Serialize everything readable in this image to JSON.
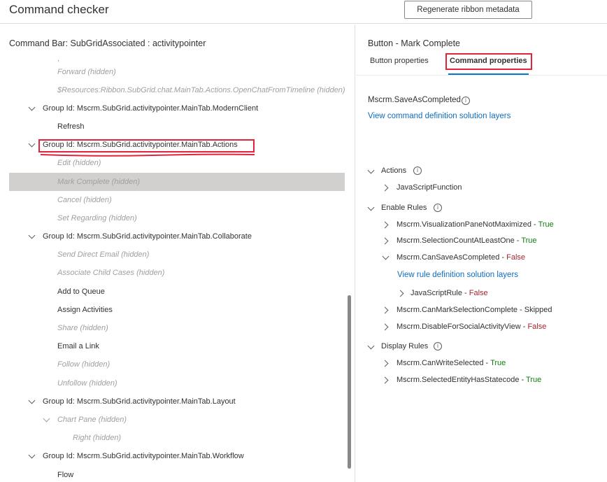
{
  "app": {
    "title": "Command checker",
    "regenerate_label": "Regenerate ribbon metadata"
  },
  "left": {
    "command_bar_title": "Command Bar: SubGridAssociated : activitypointer",
    "items": [
      {
        "label": "Forward (hidden)"
      },
      {
        "label": "$Resources:Ribbon.SubGrid.chat.MainTab.Actions.OpenChatFromTimeline (hidden)"
      },
      {
        "label": "Group Id: Mscrm.SubGrid.activitypointer.MainTab.ModernClient"
      },
      {
        "label": "Refresh"
      },
      {
        "label": "Group Id: Mscrm.SubGrid.activitypointer.MainTab.Actions"
      },
      {
        "label": "Edit (hidden)"
      },
      {
        "label": "Mark Complete (hidden)"
      },
      {
        "label": "Cancel (hidden)"
      },
      {
        "label": "Set Regarding (hidden)"
      },
      {
        "label": "Group Id: Mscrm.SubGrid.activitypointer.MainTab.Collaborate"
      },
      {
        "label": "Send Direct Email (hidden)"
      },
      {
        "label": "Associate Child Cases (hidden)"
      },
      {
        "label": "Add to Queue"
      },
      {
        "label": "Assign Activities"
      },
      {
        "label": "Share (hidden)"
      },
      {
        "label": "Email a Link"
      },
      {
        "label": "Follow (hidden)"
      },
      {
        "label": "Unfollow (hidden)"
      },
      {
        "label": "Group Id: Mscrm.SubGrid.activitypointer.MainTab.Layout"
      },
      {
        "label": "Chart Pane (hidden)"
      },
      {
        "label": "Right (hidden)"
      },
      {
        "label": "Group Id: Mscrm.SubGrid.activitypointer.MainTab.Workflow"
      },
      {
        "label": "Flow"
      }
    ]
  },
  "right": {
    "panel_title": "Button - Mark Complete",
    "tabs": [
      {
        "label": "Button properties"
      },
      {
        "label": "Command properties"
      }
    ],
    "command_id": "Mscrm.SaveAsCompleted",
    "view_command_layers": "View command definition solution layers",
    "actions_label": "Actions",
    "actions": [
      "JavaScriptFunction"
    ],
    "enable_rules_label": "Enable Rules",
    "enable_rules": [
      {
        "name": "Mscrm.VisualizationPaneNotMaximized",
        "sep": " - ",
        "value": "True"
      },
      {
        "name": "Mscrm.SelectionCountAtLeastOne",
        "sep": " - ",
        "value": "True"
      },
      {
        "name": "Mscrm.CanSaveAsCompleted",
        "sep": " - ",
        "value": "False"
      },
      {
        "name": "Mscrm.CanMarkSelectionComplete",
        "sep": " - ",
        "value": "Skipped"
      },
      {
        "name": "Mscrm.DisableForSocialActivityView",
        "sep": " - ",
        "value": "False"
      }
    ],
    "view_rule_layers": "View rule definition solution layers",
    "js_rule": {
      "name": "JavaScriptRule",
      "sep": " - ",
      "value": "False"
    },
    "display_rules_label": "Display Rules",
    "display_rules": [
      {
        "name": "Mscrm.CanWriteSelected",
        "sep": " - ",
        "value": "True"
      },
      {
        "name": "Mscrm.SelectedEntityHasStatecode",
        "sep": " - ",
        "value": "True"
      }
    ],
    "info_glyph": "i"
  },
  "colors": {
    "accent": "#0078d4",
    "link": "#0f6cbd",
    "true": "#107c10",
    "false": "#a4262c",
    "highlight": "#e3223b"
  }
}
